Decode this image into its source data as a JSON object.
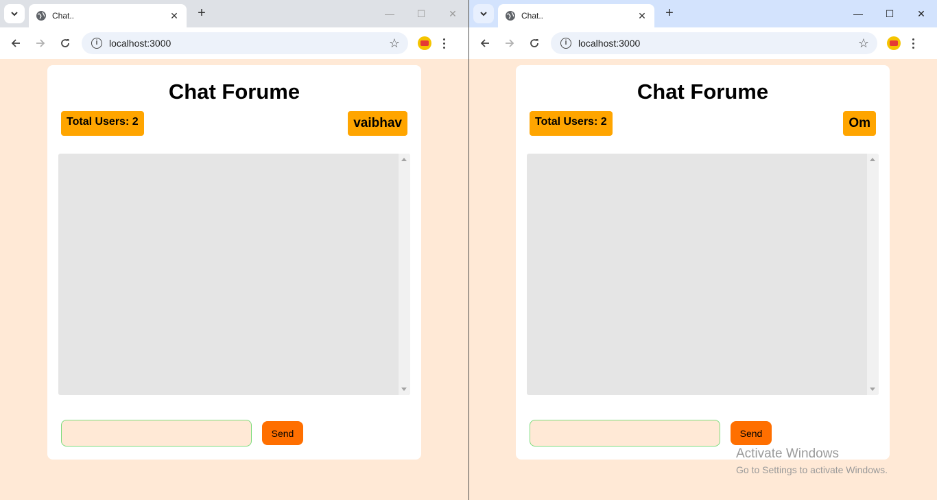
{
  "windows": [
    {
      "tab": {
        "title": "Chat.."
      },
      "address": {
        "url": "localhost:3000"
      },
      "page": {
        "title": "Chat Forume",
        "total_users_label": "Total Users: 2",
        "username": "vaibhav",
        "message_input": {
          "value": "",
          "placeholder": ""
        },
        "send_label": "Send"
      }
    },
    {
      "tab": {
        "title": "Chat.."
      },
      "address": {
        "url": "localhost:3000"
      },
      "page": {
        "title": "Chat Forume",
        "total_users_label": "Total Users: 2",
        "username": "Om",
        "message_input": {
          "value": "",
          "placeholder": ""
        },
        "send_label": "Send"
      }
    }
  ],
  "watermark": {
    "title": "Activate Windows",
    "subtitle": "Go to Settings to activate Windows."
  },
  "colors": {
    "page_background": "#ffe9d6",
    "badge": "#ffa500",
    "send_button": "#ff6f00",
    "input_border": "#7cdc7c"
  },
  "icons": [
    "tab-search-icon",
    "globe-icon",
    "close-icon",
    "new-tab-icon",
    "minimize-icon",
    "maximize-icon",
    "back-icon",
    "forward-icon",
    "reload-icon",
    "site-info-icon",
    "bookmark-star-icon",
    "extension-icon",
    "menu-icon"
  ]
}
